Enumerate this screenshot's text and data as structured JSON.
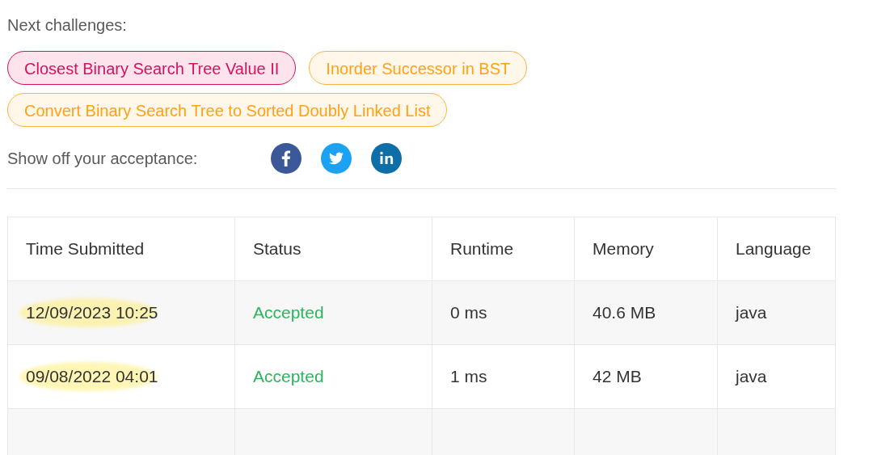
{
  "next_label": "Next challenges:",
  "challenges": [
    {
      "label": "Closest Binary Search Tree Value II",
      "kind": "hard"
    },
    {
      "label": "Inorder Successor in BST",
      "kind": "medium"
    },
    {
      "label": "Convert Binary Search Tree to Sorted Doubly Linked List",
      "kind": "medium"
    }
  ],
  "share_label": "Show off your acceptance:",
  "table": {
    "columns": [
      "Time Submitted",
      "Status",
      "Runtime",
      "Memory",
      "Language"
    ],
    "rows": [
      {
        "time": "12/09/2023 10:25",
        "highlighted": true,
        "status": "Accepted",
        "runtime": "0 ms",
        "memory": "40.6 MB",
        "language": "java"
      },
      {
        "time": "09/08/2022 04:01",
        "highlighted": true,
        "status": "Accepted",
        "runtime": "1 ms",
        "memory": "42 MB",
        "language": "java"
      }
    ]
  }
}
